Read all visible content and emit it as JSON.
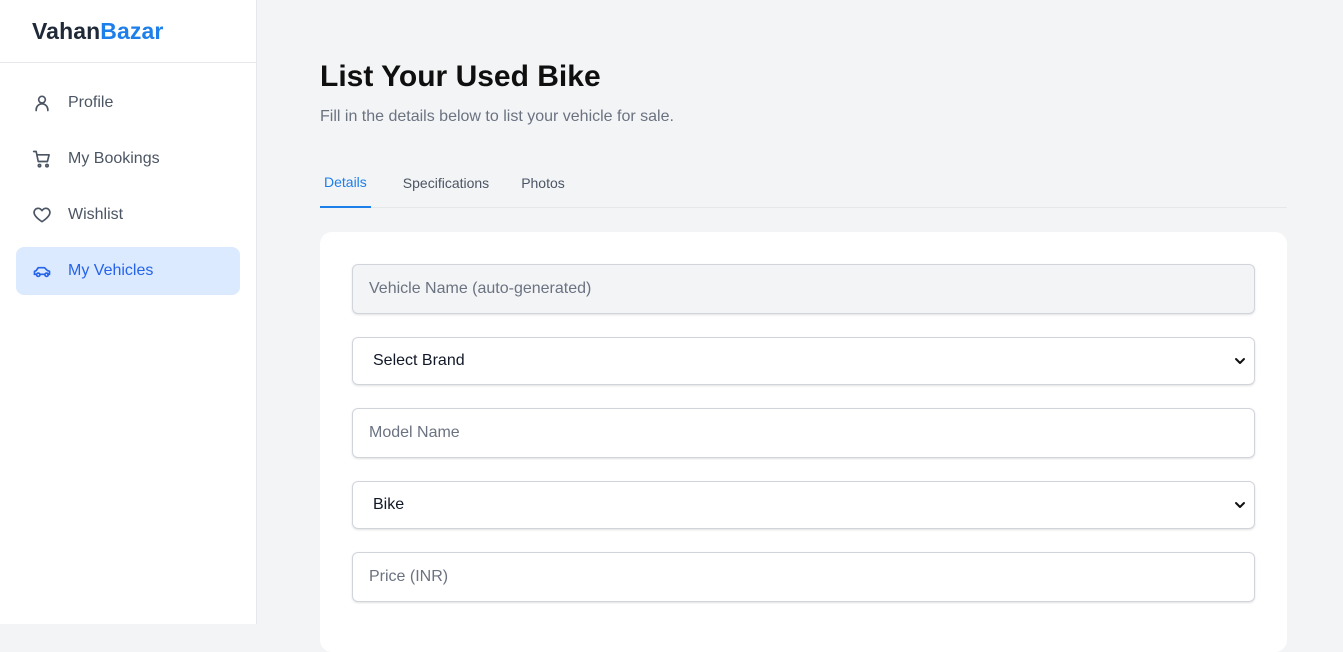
{
  "app": {
    "brand_part1": "Vahan",
    "brand_part2": "Bazar",
    "brand_color": "#1d7fea"
  },
  "sidebar": {
    "items": [
      {
        "label": "Profile",
        "icon": "user-icon",
        "active": false
      },
      {
        "label": "My Bookings",
        "icon": "cart-icon",
        "active": false
      },
      {
        "label": "Wishlist",
        "icon": "heart-icon",
        "active": false
      },
      {
        "label": "My Vehicles",
        "icon": "car-icon",
        "active": true
      }
    ]
  },
  "page": {
    "title": "List Your Used Bike",
    "subtitle": "Fill in the details below to list your vehicle for sale."
  },
  "tabs": [
    {
      "label": "Details",
      "active": true
    },
    {
      "label": "Specifications",
      "active": false
    },
    {
      "label": "Photos",
      "active": false
    }
  ],
  "form": {
    "vehicle_name": {
      "placeholder": "Vehicle Name (auto-generated)",
      "value": ""
    },
    "brand": {
      "selected": "Select Brand"
    },
    "model": {
      "placeholder": "Model Name",
      "value": ""
    },
    "type": {
      "selected": "Bike"
    },
    "price": {
      "placeholder": "Price (INR)",
      "value": ""
    }
  }
}
